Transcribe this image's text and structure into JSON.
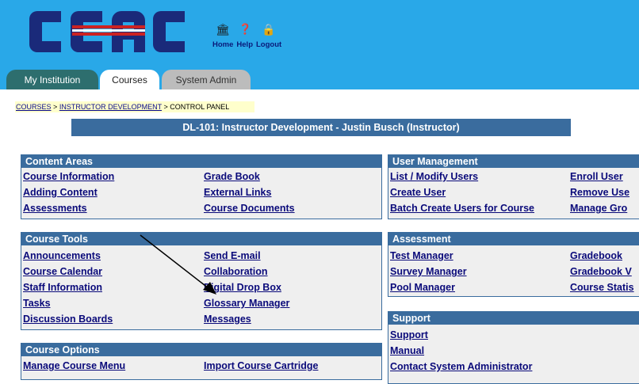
{
  "header": {
    "logo_text": "CCAC",
    "icons": [
      "home-icon",
      "help-icon",
      "logout-icon"
    ],
    "links": [
      "Home",
      "Help",
      "Logout"
    ],
    "colors": {
      "band": "#29a8e8",
      "logo_blue": "#1a2a7a",
      "logo_red": "#cc2222"
    }
  },
  "tabs": [
    "My Institution",
    "Courses",
    "System Admin"
  ],
  "breadcrumb": {
    "item1": "COURSES",
    "sep": ">",
    "item2": "INSTRUCTOR DEVELOPMENT",
    "item3": "CONTROL PANEL"
  },
  "course_title": "DL-101:  Instructor Development -  Justin Busch (Instructor)",
  "content_areas": {
    "title": "Content Areas",
    "col1": [
      "Course Information",
      "Adding Content",
      "Assessments"
    ],
    "col2": [
      "Grade Book",
      "External Links",
      "Course Documents"
    ]
  },
  "course_tools": {
    "title": "Course Tools",
    "col1": [
      "Announcements",
      "Course Calendar",
      "Staff Information",
      "Tasks",
      "Discussion Boards"
    ],
    "col2": [
      "Send E-mail",
      "Collaboration",
      "Digital Drop Box",
      "Glossary Manager",
      "Messages"
    ]
  },
  "course_options": {
    "title": "Course Options",
    "col1": [
      "Manage Course Menu"
    ],
    "col2": [
      "Import Course Cartridge"
    ]
  },
  "user_management": {
    "title": "User Management",
    "col1": [
      "List / Modify Users",
      "Create User",
      "Batch Create Users for Course"
    ],
    "col2": [
      "Enroll User",
      "Remove Use",
      "Manage Gro"
    ]
  },
  "assessment": {
    "title": "Assessment",
    "col1": [
      "Test Manager",
      "Survey Manager",
      "Pool Manager"
    ],
    "col2": [
      "Gradebook",
      "Gradebook V",
      "Course Statis"
    ]
  },
  "support": {
    "title": "Support",
    "items": [
      "Support",
      "Manual",
      "Contact System Administrator"
    ]
  }
}
